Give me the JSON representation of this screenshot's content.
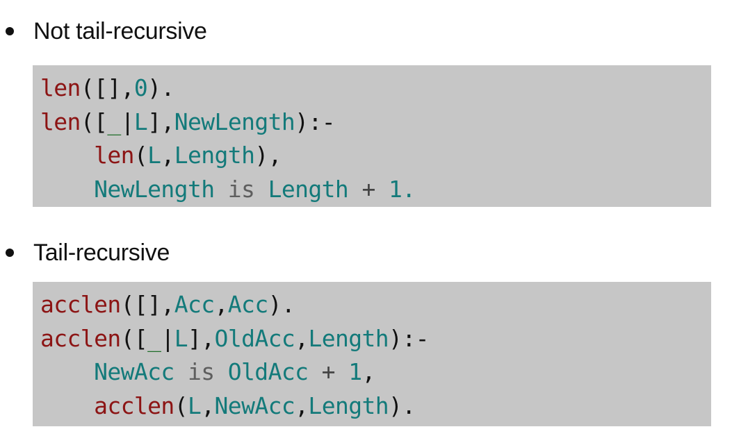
{
  "sections": [
    {
      "bullet": "Not tail-recursive",
      "code": [
        [
          {
            "t": "len",
            "c": "pred"
          },
          {
            "t": "([],",
            "c": "punc"
          },
          {
            "t": "0",
            "c": "num"
          },
          {
            "t": ").",
            "c": "punc"
          }
        ],
        [
          {
            "t": "len",
            "c": "pred"
          },
          {
            "t": "([",
            "c": "punc"
          },
          {
            "t": "_",
            "c": "anon"
          },
          {
            "t": "|",
            "c": "punc"
          },
          {
            "t": "L",
            "c": "var"
          },
          {
            "t": "],",
            "c": "punc"
          },
          {
            "t": "NewLength",
            "c": "var"
          },
          {
            "t": "):-",
            "c": "punc"
          }
        ],
        [
          {
            "t": "    ",
            "c": "punc"
          },
          {
            "t": "len",
            "c": "pred"
          },
          {
            "t": "(",
            "c": "punc"
          },
          {
            "t": "L",
            "c": "var"
          },
          {
            "t": ",",
            "c": "punc"
          },
          {
            "t": "Length",
            "c": "var"
          },
          {
            "t": "),",
            "c": "punc"
          }
        ],
        [
          {
            "t": "    ",
            "c": "punc"
          },
          {
            "t": "NewLength",
            "c": "var"
          },
          {
            "t": " is ",
            "c": "kw"
          },
          {
            "t": "Length",
            "c": "var"
          },
          {
            "t": " + ",
            "c": "op"
          },
          {
            "t": "1.",
            "c": "num"
          }
        ]
      ]
    },
    {
      "bullet": "Tail-recursive",
      "code": [
        [
          {
            "t": "acclen",
            "c": "pred"
          },
          {
            "t": "([],",
            "c": "punc"
          },
          {
            "t": "Acc",
            "c": "var"
          },
          {
            "t": ",",
            "c": "punc"
          },
          {
            "t": "Acc",
            "c": "var"
          },
          {
            "t": ").",
            "c": "punc"
          }
        ],
        [
          {
            "t": "acclen",
            "c": "pred"
          },
          {
            "t": "([",
            "c": "punc"
          },
          {
            "t": "_",
            "c": "anon"
          },
          {
            "t": "|",
            "c": "punc"
          },
          {
            "t": "L",
            "c": "var"
          },
          {
            "t": "],",
            "c": "punc"
          },
          {
            "t": "OldAcc",
            "c": "var"
          },
          {
            "t": ",",
            "c": "punc"
          },
          {
            "t": "Length",
            "c": "var"
          },
          {
            "t": "):-",
            "c": "punc"
          }
        ],
        [
          {
            "t": "    ",
            "c": "punc"
          },
          {
            "t": "NewAcc",
            "c": "var"
          },
          {
            "t": " is ",
            "c": "kw"
          },
          {
            "t": "OldAcc",
            "c": "var"
          },
          {
            "t": " + ",
            "c": "op"
          },
          {
            "t": "1",
            "c": "num"
          },
          {
            "t": ",",
            "c": "punc"
          }
        ],
        [
          {
            "t": "    ",
            "c": "punc"
          },
          {
            "t": "acclen",
            "c": "pred"
          },
          {
            "t": "(",
            "c": "punc"
          },
          {
            "t": "L",
            "c": "var"
          },
          {
            "t": ",",
            "c": "punc"
          },
          {
            "t": "NewAcc",
            "c": "var"
          },
          {
            "t": ",",
            "c": "punc"
          },
          {
            "t": "Length",
            "c": "var"
          },
          {
            "t": ").",
            "c": "punc"
          }
        ]
      ]
    }
  ],
  "colors": {
    "code_background": "#c6c6c6",
    "predicate": "#8c1414",
    "variable": "#137a7a",
    "number": "#137a7a",
    "keyword": "#5e5e5e",
    "anonymous": "#1f6e2a",
    "punctuation": "#111111"
  }
}
